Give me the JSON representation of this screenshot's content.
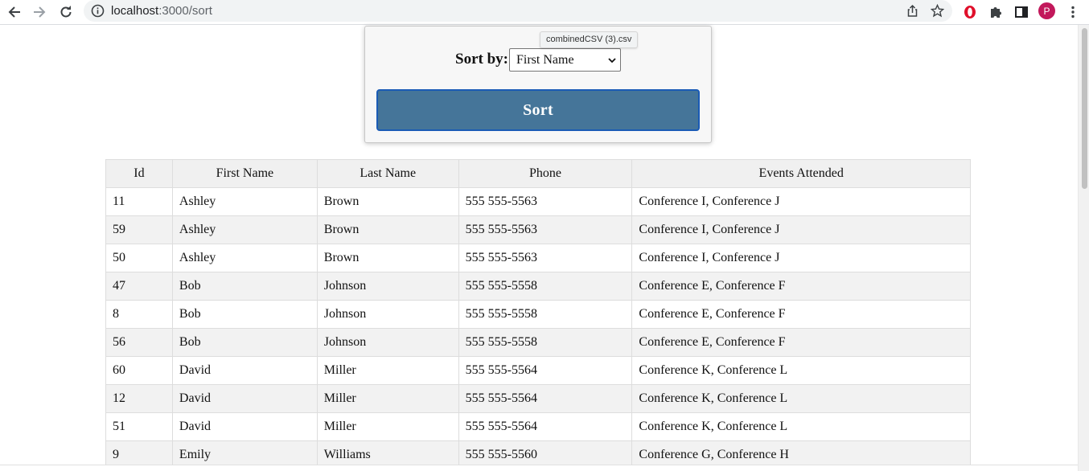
{
  "browser": {
    "url_host": "localhost",
    "url_rest": ":3000/sort",
    "profile_initial": "P"
  },
  "sort_panel": {
    "label": "Sort by:",
    "selected": "First Name",
    "button_label": "Sort"
  },
  "tooltip": "combinedCSV (3).csv",
  "table": {
    "headers": [
      "Id",
      "First Name",
      "Last Name",
      "Phone",
      "Events Attended"
    ],
    "rows": [
      [
        "11",
        "Ashley",
        "Brown",
        "555 555-5563",
        "Conference I, Conference J"
      ],
      [
        "59",
        "Ashley",
        "Brown",
        "555 555-5563",
        "Conference I, Conference J"
      ],
      [
        "50",
        "Ashley",
        "Brown",
        "555 555-5563",
        "Conference I, Conference J"
      ],
      [
        "47",
        "Bob",
        "Johnson",
        "555 555-5558",
        "Conference E, Conference F"
      ],
      [
        "8",
        "Bob",
        "Johnson",
        "555 555-5558",
        "Conference E, Conference F"
      ],
      [
        "56",
        "Bob",
        "Johnson",
        "555 555-5558",
        "Conference E, Conference F"
      ],
      [
        "60",
        "David",
        "Miller",
        "555 555-5564",
        "Conference K, Conference L"
      ],
      [
        "12",
        "David",
        "Miller",
        "555 555-5564",
        "Conference K, Conference L"
      ],
      [
        "51",
        "David",
        "Miller",
        "555 555-5564",
        "Conference K, Conference L"
      ],
      [
        "9",
        "Emily",
        "Williams",
        "555 555-5560",
        "Conference G, Conference H"
      ]
    ]
  }
}
